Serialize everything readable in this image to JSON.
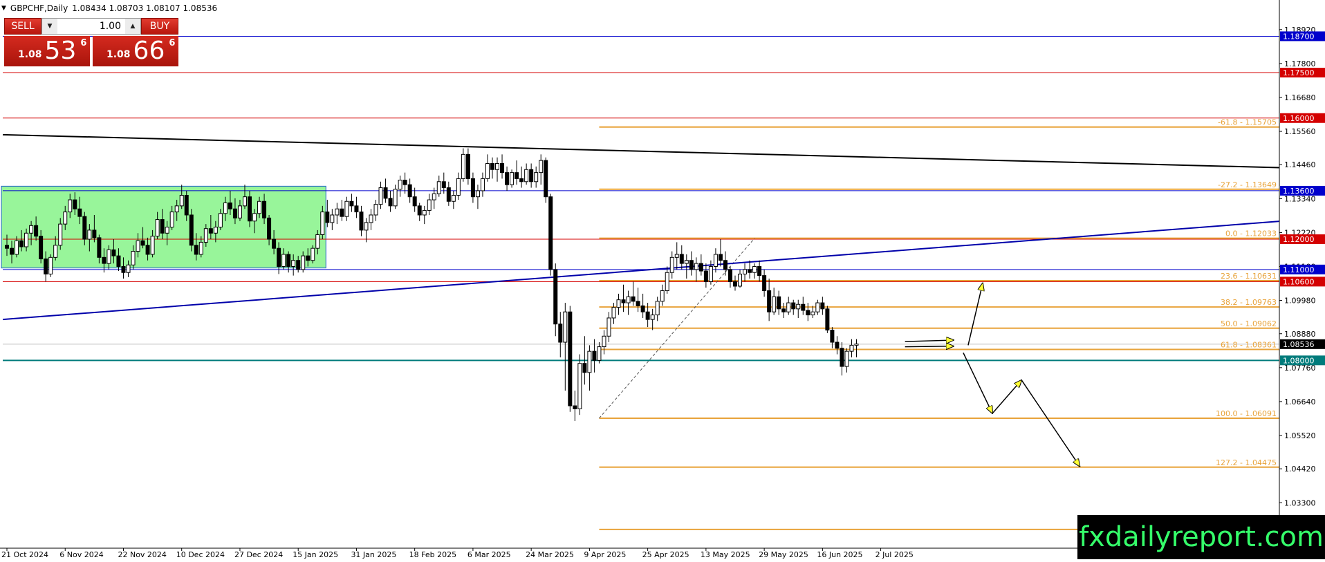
{
  "header": {
    "symbol": "GBPCHF,Daily",
    "ohlc": "1.08434 1.08703 1.08107 1.08536"
  },
  "trade_panel": {
    "sell_label": "SELL",
    "buy_label": "BUY",
    "lot_value": "1.00",
    "sell_prefix": "1.08",
    "sell_big": "53",
    "sell_sup": "6",
    "buy_prefix": "1.08",
    "buy_big": "66",
    "buy_sup": "6"
  },
  "watermark": "fxdailyreport.com",
  "colors": {
    "blue_level": "#0000cc",
    "red_level": "#d40000",
    "teal_level": "#007b7b",
    "fib": "#e8a33a",
    "zone": "#98f59a",
    "current": "#000000"
  },
  "chart_data": {
    "type": "candlestick",
    "symbol": "GBPCHF",
    "timeframe": "Daily",
    "y_axis": {
      "range": [
        1.018,
        1.1976
      ],
      "ticks": [
        "1.18920",
        "1.17800",
        "1.16680",
        "1.15560",
        "1.14460",
        "1.13340",
        "1.12220",
        "1.11100",
        "1.09980",
        "1.08880",
        "1.07760",
        "1.06640",
        "1.05520",
        "1.04420",
        "1.03300"
      ]
    },
    "x_axis": {
      "labels": [
        {
          "text": "21 Oct 2024",
          "bar": 0
        },
        {
          "text": "6 Nov 2024",
          "bar": 12
        },
        {
          "text": "22 Nov 2024",
          "bar": 24
        },
        {
          "text": "10 Dec 2024",
          "bar": 36
        },
        {
          "text": "27 Dec 2024",
          "bar": 48
        },
        {
          "text": "15 Jan 2025",
          "bar": 60
        },
        {
          "text": "31 Jan 2025",
          "bar": 72
        },
        {
          "text": "18 Feb 2025",
          "bar": 84
        },
        {
          "text": "6 Mar 2025",
          "bar": 96
        },
        {
          "text": "24 Mar 2025",
          "bar": 108
        },
        {
          "text": "9 Apr 2025",
          "bar": 120
        },
        {
          "text": "25 Apr 2025",
          "bar": 132
        },
        {
          "text": "13 May 2025",
          "bar": 144
        },
        {
          "text": "29 May 2025",
          "bar": 156
        },
        {
          "text": "16 Jun 2025",
          "bar": 168
        },
        {
          "text": "2 Jul 2025",
          "bar": 180
        }
      ],
      "bars_total": 184
    },
    "price_levels": [
      {
        "price": 1.187,
        "label": "1.18700",
        "color": "blue"
      },
      {
        "price": 1.175,
        "label": "1.17500",
        "color": "red"
      },
      {
        "price": 1.16,
        "label": "1.16000",
        "color": "red"
      },
      {
        "price": 1.136,
        "label": "1.13600",
        "color": "blue"
      },
      {
        "price": 1.12,
        "label": "1.12000",
        "color": "red"
      },
      {
        "price": 1.11,
        "label": "1.11000",
        "color": "blue"
      },
      {
        "price": 1.106,
        "label": "1.10600",
        "color": "red"
      },
      {
        "price": 1.08,
        "label": "1.08000",
        "color": "teal"
      }
    ],
    "current_price": {
      "price": 1.08536,
      "label": "1.08536"
    },
    "fibonacci": [
      {
        "level": "-61.8",
        "price": 1.15705,
        "label": "-61.8 - 1.15705"
      },
      {
        "level": "-27.2",
        "price": 1.13649,
        "label": "-27.2 - 1.13649"
      },
      {
        "level": "0.0",
        "price": 1.12033,
        "label": "0.0 - 1.12033"
      },
      {
        "level": "23.6",
        "price": 1.10631,
        "label": "23.6 - 1.10631"
      },
      {
        "level": "38.2",
        "price": 1.09763,
        "label": "38.2 - 1.09763"
      },
      {
        "level": "50.0",
        "price": 1.09062,
        "label": "50.0 - 1.09062"
      },
      {
        "level": "61.8",
        "price": 1.08361,
        "label": "61.8 - 1.08361"
      },
      {
        "level": "100.0",
        "price": 1.06091,
        "label": "100.0 - 1.06091"
      },
      {
        "level": "127.2",
        "price": 1.04475,
        "label": "127.2 - 1.04475"
      },
      {
        "level": "161.8",
        "price": 1.0242,
        "label": ""
      }
    ],
    "fib_start_bar": 122,
    "consolidation_zone": {
      "from_bar": 0,
      "to_bar": 64,
      "high": 1.1375,
      "low": 1.1105
    },
    "trendlines": [
      {
        "name": "descending-black",
        "color": "#000000",
        "from": {
          "bar": 0,
          "price": 1.1545
        },
        "to": {
          "bar": 236,
          "price": 1.1447
        }
      },
      {
        "name": "ascending-blue",
        "color": "#0000aa",
        "from": {
          "bar": 0,
          "price": 1.0935
        },
        "to": {
          "bar": 236,
          "price": 1.1227
        }
      }
    ],
    "fib_anchor_line": {
      "from": {
        "bar": 122,
        "price": 1.0609
      },
      "to": {
        "bar": 154,
        "price": 1.1203
      }
    },
    "projection_arrows": [
      {
        "from": {
          "bar": 185,
          "price": 1.0862
        },
        "to": {
          "bar": 195,
          "price": 1.0867
        }
      },
      {
        "from": {
          "bar": 185,
          "price": 1.0845
        },
        "to": {
          "bar": 195,
          "price": 1.0847
        }
      },
      {
        "from": {
          "bar": 198,
          "price": 1.085
        },
        "to": {
          "bar": 201,
          "price": 1.1055
        }
      },
      {
        "from": {
          "bar": 197,
          "price": 1.0825
        },
        "to": {
          "bar": 203,
          "price": 1.0625
        }
      },
      {
        "from": {
          "bar": 203,
          "price": 1.0625
        },
        "to": {
          "bar": 209,
          "price": 1.0735
        }
      },
      {
        "from": {
          "bar": 209,
          "price": 1.0735
        },
        "to": {
          "bar": 221,
          "price": 1.045
        }
      }
    ],
    "ohlc": [
      [
        1.118,
        1.1215,
        1.1145,
        1.117
      ],
      [
        1.117,
        1.1195,
        1.112,
        1.115
      ],
      [
        1.115,
        1.121,
        1.114,
        1.1195
      ],
      [
        1.1195,
        1.123,
        1.116,
        1.1175
      ],
      [
        1.1175,
        1.1235,
        1.116,
        1.122
      ],
      [
        1.122,
        1.126,
        1.118,
        1.1245
      ],
      [
        1.1245,
        1.1275,
        1.1195,
        1.121
      ],
      [
        1.121,
        1.123,
        1.112,
        1.1135
      ],
      [
        1.1135,
        1.116,
        1.106,
        1.1085
      ],
      [
        1.1085,
        1.115,
        1.1075,
        1.114
      ],
      [
        1.114,
        1.121,
        1.113,
        1.118
      ],
      [
        1.118,
        1.127,
        1.1165,
        1.125
      ],
      [
        1.125,
        1.131,
        1.123,
        1.129
      ],
      [
        1.129,
        1.135,
        1.127,
        1.133
      ],
      [
        1.133,
        1.1355,
        1.128,
        1.13
      ],
      [
        1.13,
        1.134,
        1.125,
        1.1275
      ],
      [
        1.1275,
        1.129,
        1.118,
        1.12
      ],
      [
        1.12,
        1.125,
        1.116,
        1.123
      ],
      [
        1.123,
        1.128,
        1.119,
        1.1205
      ],
      [
        1.1205,
        1.1215,
        1.112,
        1.114
      ],
      [
        1.114,
        1.117,
        1.109,
        1.112
      ],
      [
        1.112,
        1.118,
        1.11,
        1.1165
      ],
      [
        1.1165,
        1.12,
        1.112,
        1.1145
      ],
      [
        1.1145,
        1.117,
        1.1095,
        1.111
      ],
      [
        1.111,
        1.114,
        1.107,
        1.109
      ],
      [
        1.109,
        1.113,
        1.1075,
        1.1115
      ],
      [
        1.1115,
        1.118,
        1.11,
        1.116
      ],
      [
        1.116,
        1.122,
        1.114,
        1.1195
      ],
      [
        1.1195,
        1.124,
        1.117,
        1.118
      ],
      [
        1.118,
        1.1205,
        1.113,
        1.115
      ],
      [
        1.115,
        1.123,
        1.114,
        1.121
      ],
      [
        1.121,
        1.129,
        1.12,
        1.1265
      ],
      [
        1.1265,
        1.13,
        1.12,
        1.122
      ],
      [
        1.122,
        1.126,
        1.118,
        1.124
      ],
      [
        1.124,
        1.131,
        1.123,
        1.129
      ],
      [
        1.129,
        1.133,
        1.126,
        1.131
      ],
      [
        1.131,
        1.138,
        1.13,
        1.1345
      ],
      [
        1.1345,
        1.136,
        1.126,
        1.128
      ],
      [
        1.128,
        1.13,
        1.116,
        1.118
      ],
      [
        1.118,
        1.122,
        1.113,
        1.115
      ],
      [
        1.115,
        1.121,
        1.114,
        1.119
      ],
      [
        1.119,
        1.125,
        1.1175,
        1.1235
      ],
      [
        1.1235,
        1.128,
        1.12,
        1.122
      ],
      [
        1.122,
        1.126,
        1.119,
        1.124
      ],
      [
        1.124,
        1.13,
        1.123,
        1.1285
      ],
      [
        1.1285,
        1.134,
        1.126,
        1.132
      ],
      [
        1.132,
        1.136,
        1.128,
        1.13
      ],
      [
        1.13,
        1.1335,
        1.125,
        1.127
      ],
      [
        1.127,
        1.133,
        1.126,
        1.131
      ],
      [
        1.131,
        1.138,
        1.13,
        1.134
      ],
      [
        1.134,
        1.136,
        1.124,
        1.126
      ],
      [
        1.126,
        1.13,
        1.122,
        1.1285
      ],
      [
        1.1285,
        1.134,
        1.127,
        1.1325
      ],
      [
        1.1325,
        1.135,
        1.125,
        1.127
      ],
      [
        1.127,
        1.128,
        1.118,
        1.12
      ],
      [
        1.12,
        1.123,
        1.115,
        1.117
      ],
      [
        1.117,
        1.119,
        1.1085,
        1.111
      ],
      [
        1.111,
        1.117,
        1.11,
        1.115
      ],
      [
        1.115,
        1.116,
        1.109,
        1.111
      ],
      [
        1.111,
        1.115,
        1.108,
        1.113
      ],
      [
        1.113,
        1.1145,
        1.109,
        1.11
      ],
      [
        1.11,
        1.116,
        1.109,
        1.1145
      ],
      [
        1.1145,
        1.117,
        1.111,
        1.113
      ],
      [
        1.113,
        1.118,
        1.112,
        1.117
      ],
      [
        1.117,
        1.123,
        1.115,
        1.1215
      ],
      [
        1.1215,
        1.131,
        1.12,
        1.129
      ],
      [
        1.129,
        1.133,
        1.124,
        1.1255
      ],
      [
        1.1255,
        1.13,
        1.123,
        1.128
      ],
      [
        1.128,
        1.132,
        1.125,
        1.13
      ],
      [
        1.13,
        1.133,
        1.126,
        1.1275
      ],
      [
        1.1275,
        1.134,
        1.126,
        1.1325
      ],
      [
        1.1325,
        1.135,
        1.129,
        1.131
      ],
      [
        1.131,
        1.134,
        1.127,
        1.129
      ],
      [
        1.129,
        1.131,
        1.121,
        1.123
      ],
      [
        1.123,
        1.127,
        1.119,
        1.1255
      ],
      [
        1.1255,
        1.13,
        1.123,
        1.128
      ],
      [
        1.128,
        1.133,
        1.126,
        1.1315
      ],
      [
        1.1315,
        1.139,
        1.13,
        1.137
      ],
      [
        1.137,
        1.14,
        1.132,
        1.1335
      ],
      [
        1.1335,
        1.136,
        1.129,
        1.131
      ],
      [
        1.131,
        1.138,
        1.13,
        1.1365
      ],
      [
        1.1365,
        1.141,
        1.134,
        1.1395
      ],
      [
        1.1395,
        1.142,
        1.135,
        1.138
      ],
      [
        1.138,
        1.14,
        1.132,
        1.134
      ],
      [
        1.134,
        1.137,
        1.129,
        1.131
      ],
      [
        1.131,
        1.132,
        1.126,
        1.128
      ],
      [
        1.128,
        1.131,
        1.125,
        1.1295
      ],
      [
        1.1295,
        1.135,
        1.128,
        1.133
      ],
      [
        1.133,
        1.137,
        1.13,
        1.135
      ],
      [
        1.135,
        1.141,
        1.134,
        1.139
      ],
      [
        1.139,
        1.142,
        1.135,
        1.137
      ],
      [
        1.137,
        1.139,
        1.131,
        1.1325
      ],
      [
        1.1325,
        1.136,
        1.13,
        1.1345
      ],
      [
        1.1345,
        1.142,
        1.133,
        1.14
      ],
      [
        1.14,
        1.15,
        1.139,
        1.148
      ],
      [
        1.148,
        1.15,
        1.138,
        1.14
      ],
      [
        1.14,
        1.142,
        1.132,
        1.134
      ],
      [
        1.134,
        1.138,
        1.13,
        1.136
      ],
      [
        1.136,
        1.142,
        1.134,
        1.14
      ],
      [
        1.14,
        1.148,
        1.139,
        1.145
      ],
      [
        1.145,
        1.147,
        1.14,
        1.143
      ],
      [
        1.143,
        1.147,
        1.139,
        1.145
      ],
      [
        1.145,
        1.148,
        1.14,
        1.142
      ],
      [
        1.142,
        1.144,
        1.136,
        1.138
      ],
      [
        1.138,
        1.143,
        1.137,
        1.142
      ],
      [
        1.142,
        1.146,
        1.138,
        1.14
      ],
      [
        1.14,
        1.144,
        1.137,
        1.139
      ],
      [
        1.139,
        1.145,
        1.138,
        1.143
      ],
      [
        1.143,
        1.145,
        1.137,
        1.139
      ],
      [
        1.139,
        1.144,
        1.137,
        1.142
      ],
      [
        1.142,
        1.148,
        1.138,
        1.146
      ],
      [
        1.146,
        1.147,
        1.132,
        1.134
      ],
      [
        1.134,
        1.135,
        1.108,
        1.11
      ],
      [
        1.11,
        1.112,
        1.088,
        1.092
      ],
      [
        1.092,
        1.096,
        1.081,
        1.086
      ],
      [
        1.086,
        1.099,
        1.07,
        1.096
      ],
      [
        1.096,
        1.098,
        1.063,
        1.065
      ],
      [
        1.065,
        1.07,
        1.06,
        1.064
      ],
      [
        1.064,
        1.082,
        1.062,
        1.079
      ],
      [
        1.079,
        1.088,
        1.072,
        1.076
      ],
      [
        1.076,
        1.085,
        1.07,
        1.083
      ],
      [
        1.083,
        1.087,
        1.076,
        1.08
      ],
      [
        1.08,
        1.086,
        1.079,
        1.0845
      ],
      [
        1.0845,
        1.09,
        1.082,
        1.088
      ],
      [
        1.088,
        1.096,
        1.086,
        1.094
      ],
      [
        1.094,
        1.099,
        1.092,
        1.0975
      ],
      [
        1.0975,
        1.102,
        1.095,
        1.1
      ],
      [
        1.1,
        1.105,
        1.096,
        1.099
      ],
      [
        1.099,
        1.103,
        1.095,
        1.101
      ],
      [
        1.101,
        1.106,
        1.098,
        1.0995
      ],
      [
        1.0995,
        1.104,
        1.096,
        1.098
      ],
      [
        1.098,
        1.102,
        1.094,
        1.096
      ],
      [
        1.096,
        1.099,
        1.091,
        1.0935
      ],
      [
        1.0935,
        1.097,
        1.09,
        1.095
      ],
      [
        1.095,
        1.101,
        1.093,
        1.0995
      ],
      [
        1.0995,
        1.105,
        1.098,
        1.103
      ],
      [
        1.103,
        1.111,
        1.102,
        1.109
      ],
      [
        1.109,
        1.116,
        1.107,
        1.114
      ],
      [
        1.114,
        1.119,
        1.11,
        1.115
      ],
      [
        1.115,
        1.118,
        1.11,
        1.112
      ],
      [
        1.112,
        1.115,
        1.107,
        1.113
      ],
      [
        1.113,
        1.116,
        1.108,
        1.11
      ],
      [
        1.11,
        1.114,
        1.106,
        1.112
      ],
      [
        1.112,
        1.115,
        1.108,
        1.1095
      ],
      [
        1.1095,
        1.112,
        1.104,
        1.106
      ],
      [
        1.106,
        1.113,
        1.105,
        1.111
      ],
      [
        1.111,
        1.117,
        1.109,
        1.115
      ],
      [
        1.115,
        1.12,
        1.111,
        1.113
      ],
      [
        1.113,
        1.116,
        1.108,
        1.11
      ],
      [
        1.11,
        1.111,
        1.104,
        1.106
      ],
      [
        1.106,
        1.108,
        1.103,
        1.1045
      ],
      [
        1.1045,
        1.11,
        1.104,
        1.1085
      ],
      [
        1.1085,
        1.112,
        1.106,
        1.11
      ],
      [
        1.11,
        1.113,
        1.107,
        1.109
      ],
      [
        1.109,
        1.112,
        1.107,
        1.111
      ],
      [
        1.111,
        1.113,
        1.106,
        1.108
      ],
      [
        1.108,
        1.11,
        1.101,
        1.103
      ],
      [
        1.103,
        1.107,
        1.093,
        1.096
      ],
      [
        1.096,
        1.104,
        1.095,
        1.101
      ],
      [
        1.101,
        1.103,
        1.095,
        1.097
      ],
      [
        1.097,
        1.099,
        1.094,
        1.096
      ],
      [
        1.096,
        1.101,
        1.095,
        1.099
      ],
      [
        1.099,
        1.1,
        1.095,
        1.097
      ],
      [
        1.097,
        1.1,
        1.094,
        1.0985
      ],
      [
        1.0985,
        1.101,
        1.095,
        1.0965
      ],
      [
        1.0965,
        1.099,
        1.093,
        1.095
      ],
      [
        1.095,
        1.098,
        1.094,
        1.096
      ],
      [
        1.096,
        1.1,
        1.095,
        1.099
      ],
      [
        1.099,
        1.101,
        1.095,
        1.097
      ],
      [
        1.097,
        1.098,
        1.089,
        1.09
      ],
      [
        1.09,
        1.091,
        1.084,
        1.086
      ],
      [
        1.086,
        1.088,
        1.082,
        1.084
      ],
      [
        1.084,
        1.086,
        1.075,
        1.078
      ],
      [
        1.078,
        1.084,
        1.076,
        1.083
      ],
      [
        1.083,
        1.087,
        1.081,
        1.085
      ],
      [
        1.085,
        1.087,
        1.081,
        1.0854
      ]
    ]
  }
}
